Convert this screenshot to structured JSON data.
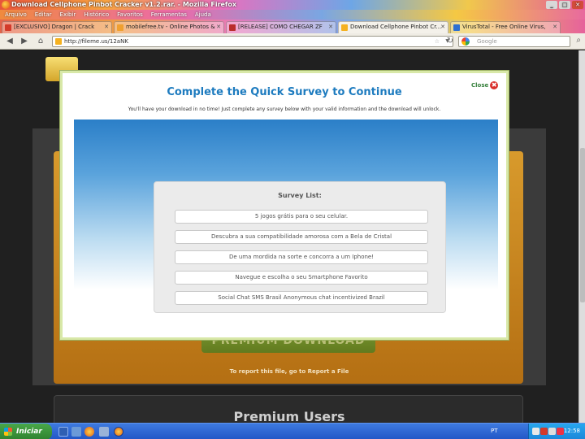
{
  "window": {
    "title": "Download Cellphone Pinbot Cracker v1.2.rar. - Mozilla Firefox",
    "minimize": "_",
    "maximize": "□",
    "close": "✕"
  },
  "menu": [
    "Arquivo",
    "Editar",
    "Exibir",
    "Histórico",
    "Favoritos",
    "Ferramentas",
    "Ajuda"
  ],
  "tabs": [
    {
      "label": "[EXCLUSIVO] Dragon | Crack",
      "icon_color": "#d33a2a",
      "active": false
    },
    {
      "label": "mobilefree.tv - Online Photos &",
      "icon_color": "#f0a030",
      "active": false
    },
    {
      "label": "[RELEASE] COMO CHEGAR ZF",
      "icon_color": "#b92d2d",
      "active": false
    },
    {
      "label": "Download Cellphone Pinbot Cr...",
      "icon_color": "#f5b120",
      "active": true
    },
    {
      "label": "VirusTotal - Free Online Virus,",
      "icon_color": "#2d6fd1",
      "active": false
    }
  ],
  "tab_close": "✕",
  "nav": {
    "back_icon": "◀",
    "forward_icon": "▶",
    "home_icon": "⌂",
    "url": "http://fileme.us/12aNK",
    "bookmark_star": "☆",
    "dropdown": "▼",
    "reload_icon": "↻",
    "search_placeholder": "Google",
    "search_icon": "⌕"
  },
  "page": {
    "report_text": "To report this file, go to Report a File",
    "premium_users": "Premium Users"
  },
  "modal": {
    "title": "Complete the Quick Survey to Continue",
    "close_label": "Close",
    "close_icon": "✖",
    "description": "You'll have your download in no time! Just complete any survey below with your valid information and the download will unlock.",
    "survey_heading": "Survey List:",
    "surveys": [
      "5 jogos grátis para o seu celular.",
      "Descubra a sua compatibilidade amorosa com a Bela de Cristal",
      "De uma mordida na sorte e concorra a um Iphone!",
      "Navegue e escolha o seu Smartphone Favorito",
      "Social Chat SMS Brasil Anonymous chat incentivized Brazil"
    ]
  },
  "taskbar": {
    "start": "Iniciar",
    "language": "PT",
    "time": "12:58"
  },
  "colors": {
    "modal_title": "#1d7bbf",
    "close_green": "#37813d",
    "taskbar_blue": "#2357c7",
    "start_green": "#2f822f"
  }
}
